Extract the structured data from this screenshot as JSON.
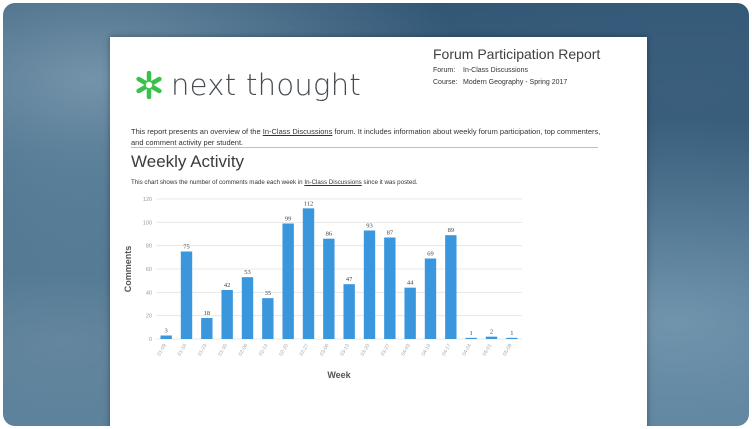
{
  "brand": {
    "name": "next thought",
    "accent": "#38c24a"
  },
  "report": {
    "title": "Forum Participation Report",
    "forum_key": "Forum:",
    "forum_value": "In-Class Discussions",
    "course_key": "Course:",
    "course_value": "Modern Geography - Spring 2017"
  },
  "intro": {
    "before": "This report presents an overview of the ",
    "link": "In-Class Discussions",
    "after": " forum. It includes information about weekly forum participation, top commenters, and comment activity per student."
  },
  "section": {
    "title": "Weekly Activity",
    "desc_before": "This chart shows the number of comments made each week in ",
    "desc_link": "In-Class Discussions",
    "desc_after": " since it was posted."
  },
  "chart_data": {
    "type": "bar",
    "title": "",
    "xlabel": "Week",
    "ylabel": "Comments",
    "ylim": [
      0,
      120
    ],
    "yticks": [
      0,
      20,
      40,
      60,
      80,
      100,
      120
    ],
    "grid": true,
    "categories": [
      "01-09",
      "01-16",
      "01-23",
      "01-30",
      "02-06",
      "02-13",
      "02-20",
      "02-27",
      "03-06",
      "03-13",
      "03-20",
      "03-27",
      "04-03",
      "04-10",
      "04-17",
      "04-24",
      "05-01",
      "05-08"
    ],
    "values": [
      3,
      75,
      18,
      42,
      53,
      35,
      99,
      112,
      86,
      47,
      93,
      87,
      44,
      69,
      89,
      1,
      2,
      1
    ],
    "bar_color": "#3b97dd"
  }
}
